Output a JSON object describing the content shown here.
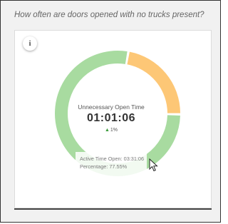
{
  "widget": {
    "title": "How often are doors opened with no trucks present?",
    "info_icon": "i"
  },
  "chart_data": {
    "type": "pie",
    "style": "donut",
    "slices": [
      {
        "label": "Active Time Open",
        "value": 77.55,
        "color": "#a8dba0"
      },
      {
        "label": "Unnecessary Open Time",
        "value": 22.45,
        "color": "#fdc776"
      }
    ],
    "center": {
      "label": "Unnecessary Open Time",
      "value": "01:01:06",
      "delta": "1%",
      "delta_direction": "up",
      "delta_color": "#3a9b3a"
    },
    "tooltip": {
      "line1": "Active Time Open: 03:31:06",
      "line2": "Percentage: 77.55%"
    }
  },
  "icons": {
    "info": "info-icon",
    "cursor": "mouse-pointer-icon"
  }
}
